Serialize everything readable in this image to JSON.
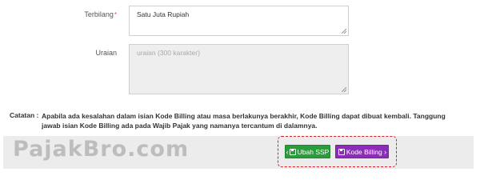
{
  "form": {
    "terbilang": {
      "label": "Terbilang",
      "required_mark": "*",
      "value": "Satu Juta  Rupiah"
    },
    "uraian": {
      "label": "Uraian",
      "placeholder": "uraian (300 karakter)"
    }
  },
  "note": {
    "label": "Catatan :",
    "text": "Apabila ada kesalahan dalam isian Kode Billing atau masa berlakunya berakhir, Kode Billing dapat dibuat kembali. Tanggung jawab isian Kode Billing ada pada Wajib Pajak yang namanya tercantum di dalamnya."
  },
  "footer": {
    "watermark": "PajakBro.com",
    "buttons": {
      "back": {
        "chevron": "‹",
        "label": "Ubah SSP",
        "icon": "save-icon",
        "color": "#2b9c3b"
      },
      "next": {
        "label": "Kode Billing",
        "chevron": "›",
        "icon": "save-icon",
        "color": "#8b2db8"
      }
    },
    "highlight_color": "#d81e2c"
  }
}
